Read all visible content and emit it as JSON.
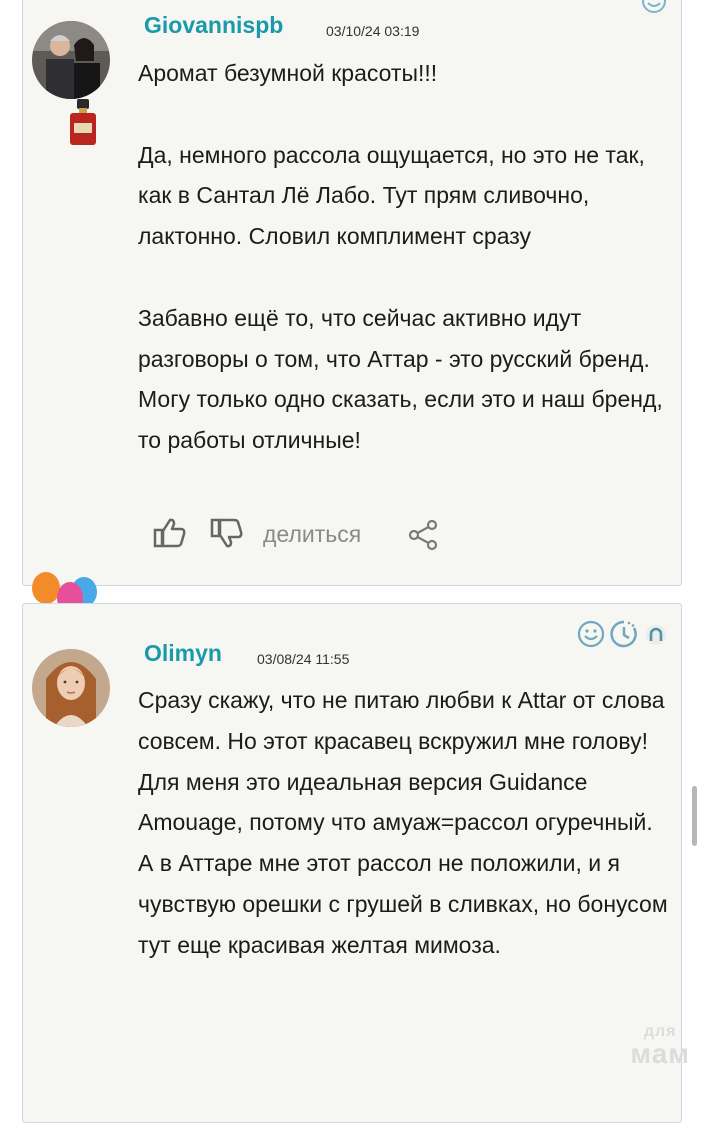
{
  "comments": [
    {
      "username": "Giovannispb",
      "date": "03/10/24 03:19",
      "paragraphs": [
        "Аромат безумной красоты!!!",
        "",
        "Да, немного рассола ощущается, но это не так, как в Сантал Лё Лабо. Тут прям сливочно, лактонно. Словил комплимент сразу",
        "",
        "Забавно ещё то, что сейчас активно идут разговоры о том, что Аттар - это русский бренд. Могу только одно сказать, если это и наш бренд, то работы отличные!"
      ],
      "share_label": "делиться"
    },
    {
      "username": "Olimyn",
      "date": "03/08/24 11:55",
      "paragraphs": [
        "Сразу скажу, что не питаю любви к Attar от слова совсем. Но этот красавец вскружил мне голову!",
        "Для меня это идеальная версия Guidance Amouage, потому что амуаж=рассол огуречный.",
        "А в Аттаре мне этот рассол не положили, и я чувствую орешки с грушей в сливках, но бонусом тут еще красивая желтая мимоза."
      ]
    }
  ],
  "watermark": {
    "line1": "для",
    "line2": "мам"
  },
  "colors": {
    "username": "#1a9aa8",
    "card_border": "#c6dbe3",
    "card_bg": "#f6f6f3"
  },
  "icons": [
    "balloon-icon",
    "perfume-bottle-icon",
    "like-icon",
    "dislike-icon",
    "share-icon",
    "smiley-icon",
    "clock-icon",
    "horseshoe-icon"
  ]
}
